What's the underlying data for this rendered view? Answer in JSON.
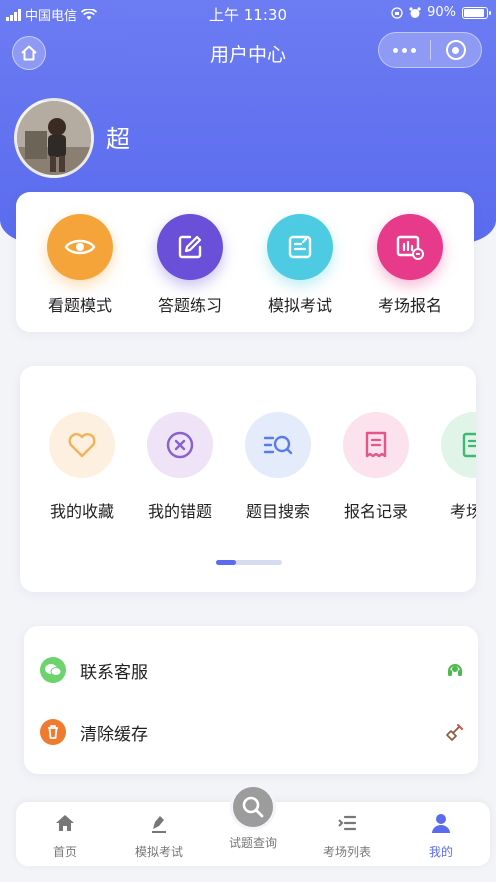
{
  "status_bar": {
    "carrier": "中国电信",
    "time": "上午 11:30",
    "battery": "90%"
  },
  "nav": {
    "title": "用户中心"
  },
  "profile": {
    "name": "超"
  },
  "quick_actions": [
    {
      "label": "看题模式",
      "icon": "eye-icon",
      "color": "#f5a43a"
    },
    {
      "label": "答题练习",
      "icon": "edit-icon",
      "color": "#6a4fd8"
    },
    {
      "label": "模拟考试",
      "icon": "exam-icon",
      "color": "#4ccbe3"
    },
    {
      "label": "考场报名",
      "icon": "register-icon",
      "color": "#e83a8a"
    }
  ],
  "tools": [
    {
      "label": "我的收藏",
      "icon": "heart-icon",
      "color": "#f3b25a",
      "bg": "#fdf0e0"
    },
    {
      "label": "我的错题",
      "icon": "close-circle-icon",
      "color": "#8a5fd0",
      "bg": "#eee3f7"
    },
    {
      "label": "题目搜索",
      "icon": "search-list-icon",
      "color": "#5a7be8",
      "bg": "#e4ebfb"
    },
    {
      "label": "报名记录",
      "icon": "receipt-icon",
      "color": "#e2568c",
      "bg": "#fbe2ec"
    },
    {
      "label": "考场人",
      "icon": "list-icon",
      "color": "#3fb873",
      "bg": "#e0f5e8"
    }
  ],
  "settings": [
    {
      "label": "联系客服",
      "icon": "wechat-icon",
      "color": "#5ac35a",
      "action_icon": "headset-icon"
    },
    {
      "label": "清除缓存",
      "icon": "trash-icon",
      "color": "#f07a2e",
      "action_icon": "broom-icon"
    }
  ],
  "tabbar": [
    {
      "label": "首页",
      "icon": "home-icon"
    },
    {
      "label": "模拟考试",
      "icon": "pen-icon"
    },
    {
      "label": "试题查询",
      "icon": "search-icon"
    },
    {
      "label": "考场列表",
      "icon": "list-icon"
    },
    {
      "label": "我的",
      "icon": "user-icon",
      "active": true
    }
  ],
  "colors": {
    "primary": "#5a6bee",
    "background": "#f3f4f8"
  }
}
